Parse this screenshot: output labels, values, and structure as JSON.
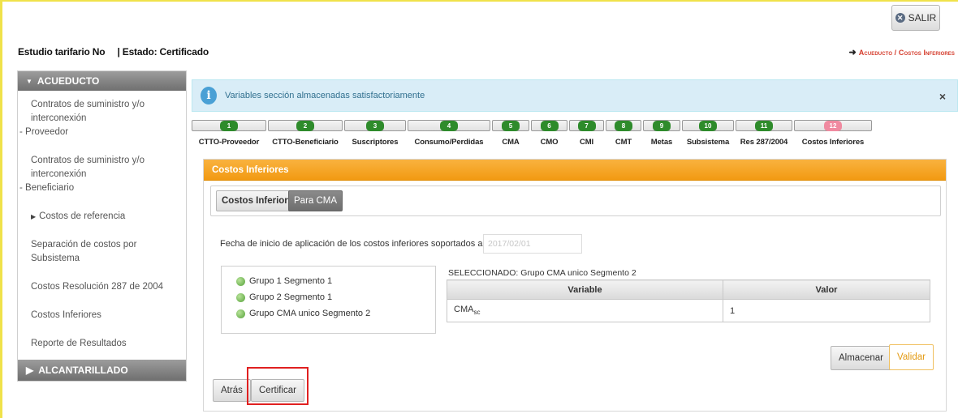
{
  "header": {
    "salir_label": "SALIR",
    "estudio_label": "Estudio tarifario No",
    "estado_label": "| Estado: Certificado",
    "breadcrumb": "Acueducto / Costos Inferiores"
  },
  "sidebar": {
    "section1_title": "ACUEDUCTO",
    "items": [
      {
        "line1": "Contratos de suministro y/o interconexión",
        "line2": "- Proveedor"
      },
      {
        "line1": "Contratos de suministro y/o interconexión",
        "line2": "- Beneficiario"
      },
      {
        "line1": "Costos de referencia"
      },
      {
        "line1": "Separación de costos por Subsistema"
      },
      {
        "line1": "Costos Resolución 287 de 2004"
      },
      {
        "line1": "Costos Inferiores"
      },
      {
        "line1": "Reporte de Resultados"
      }
    ],
    "section2_title": "ALCANTARILLADO"
  },
  "alert": {
    "message": "Variables sección almacenadas satisfactoriamente",
    "close": "×"
  },
  "steps": [
    {
      "num": "1",
      "label": "CTTO-Proveedor"
    },
    {
      "num": "2",
      "label": "CTTO-Beneficiario"
    },
    {
      "num": "3",
      "label": "Suscriptores"
    },
    {
      "num": "4",
      "label": "Consumo/Perdidas"
    },
    {
      "num": "5",
      "label": "CMA"
    },
    {
      "num": "6",
      "label": "CMO"
    },
    {
      "num": "7",
      "label": "CMI"
    },
    {
      "num": "8",
      "label": "CMT"
    },
    {
      "num": "9",
      "label": "Metas"
    },
    {
      "num": "10",
      "label": "Subsistema"
    },
    {
      "num": "11",
      "label": "Res 287/2004"
    },
    {
      "num": "12",
      "label": "Costos Inferiores"
    }
  ],
  "panel": {
    "title": "Costos Inferiores",
    "tab1": "Costos Inferiores",
    "tab2": "Para CMA",
    "fecha_label": "Fecha de inicio de aplicación de los costos inferiores soportados ante la CRA",
    "fecha_value": "2017/02/01",
    "groups": [
      "Grupo 1 Segmento 1",
      "Grupo 2 Segmento 1",
      "Grupo CMA unico Segmento 2"
    ],
    "selected_label": "SELECCIONADO: Grupo CMA unico Segmento 2",
    "table": {
      "col_variable": "Variable",
      "col_valor": "Valor",
      "row_var": "CMA",
      "row_var_sub": "sc",
      "row_val": "1"
    },
    "btn_almacenar": "Almacenar",
    "btn_validar": "Validar",
    "btn_atras": "Atrás",
    "btn_certificar": "Certificar"
  },
  "colors": {
    "step_done": "#2e8b2b",
    "step_active": "#f08aa0",
    "panel_header": "#f29a12",
    "alert_bg": "#d9edf7",
    "highlight_box": "#e02020"
  }
}
